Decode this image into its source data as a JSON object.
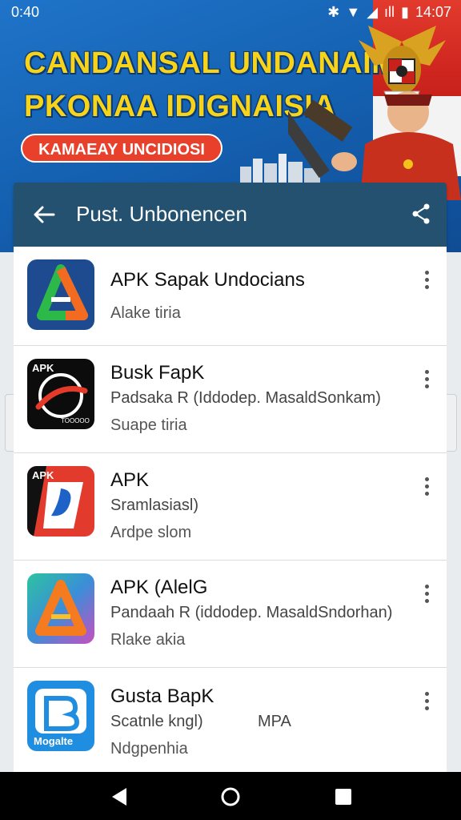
{
  "status_bar": {
    "time": "0:40",
    "clock": "14:07"
  },
  "banner": {
    "headline_line1": "CANDANSAL UNDANAIM",
    "headline_line2": "PKONAA IDIGNAISIA",
    "pill_text": "KAMAEAY UNCIDIOSI"
  },
  "appbar": {
    "title": "Pust. Unbonencen"
  },
  "apps": [
    {
      "name": "APK Sapak Undocians",
      "publisher": "",
      "meta": "Alake tiria",
      "tag": "",
      "icon": "triangle-a-green-icon"
    },
    {
      "name": "Busk FapK",
      "publisher": "Padsaka R (Iddodep. MasaldSonkam)",
      "meta": "Suape tiria",
      "tag": "",
      "icon": "apk-swoosh-icon",
      "icon_label_top": "APK",
      "icon_label_bottom": "TOOOOO"
    },
    {
      "name": "APK",
      "publisher": "Sramlasiasl)",
      "meta": "Ardpe slom",
      "tag": "",
      "icon": "apk-red-blue-icon",
      "icon_label_top": "APK"
    },
    {
      "name": "APK (AlelG",
      "publisher": "Pandaah R (iddodep. MasaldSndorhan)",
      "meta": "Rlake akia",
      "tag": "",
      "icon": "triangle-a-gradient-icon"
    },
    {
      "name": "Gusta BapK",
      "publisher": "Scatnle kngl)",
      "meta": "Ndgpenhia",
      "tag": "MPA",
      "icon": "b-square-icon",
      "icon_label_bottom": "Mogalte"
    }
  ],
  "colors": {
    "banner_blue": "#1562b3",
    "headline_yellow": "#f7d31a",
    "pill_red": "#e8402b",
    "appbar": "#23516f"
  }
}
